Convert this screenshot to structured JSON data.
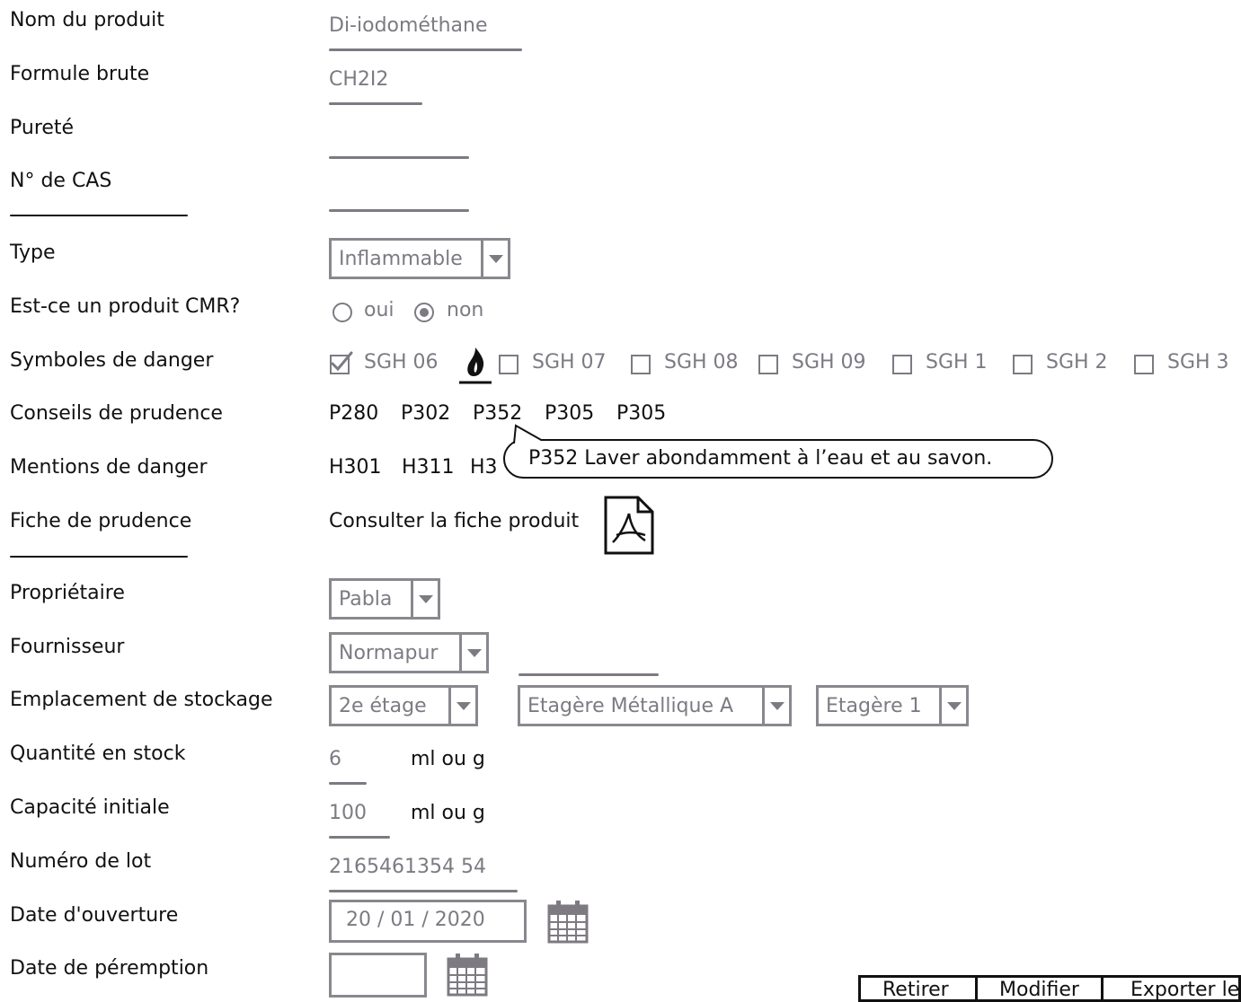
{
  "labels": {
    "product_name": "Nom du produit",
    "formula": "Formule brute",
    "purity": "Pureté",
    "cas": "N° de CAS",
    "type": "Type",
    "cmr": "Est-ce un produit CMR?",
    "hazard_symbols": "Symboles de danger",
    "precautions": "Conseils de prudence",
    "hazard_statements": "Mentions de danger",
    "safety_sheet": "Fiche de prudence",
    "owner": "Propriétaire",
    "supplier": "Fournisseur",
    "storage": "Emplacement de stockage",
    "quantity": "Quantité en stock",
    "capacity": "Capacité initiale",
    "lot": "Numéro de lot",
    "open_date": "Date d'ouverture",
    "expiry_date": "Date de péremption"
  },
  "fields": {
    "product_name": "Di-iodométhane",
    "formula": "CH2I2",
    "purity": "",
    "cas": "",
    "type": "Inflammable",
    "cmr_yes": "oui",
    "cmr_no": "non",
    "cmr_selected": "non",
    "owner": "Pabla",
    "supplier": "Normapur",
    "storage_floor": "2e étage",
    "storage_shelf": "Etagère Métallique A",
    "storage_level": "Etagère 1",
    "quantity": "6",
    "quantity_unit": "ml ou g",
    "capacity": "100",
    "capacity_unit": "ml ou g",
    "lot": "2165461354 54",
    "open_date": "20 / 01 / 2020",
    "expiry_date": ""
  },
  "hazard_symbols": [
    {
      "label": "SGH 06",
      "checked": true
    },
    {
      "label": "SGH 07",
      "checked": false
    },
    {
      "label": "SGH 08",
      "checked": false
    },
    {
      "label": "SGH 09",
      "checked": false
    },
    {
      "label": "SGH 1",
      "checked": false
    },
    {
      "label": "SGH 2",
      "checked": false
    },
    {
      "label": "SGH 3",
      "checked": false
    }
  ],
  "precautions": [
    "P280",
    "P302",
    "P352",
    "P305",
    "P305"
  ],
  "hazard_statements": [
    "H301",
    "H311",
    "H3"
  ],
  "tooltip": "P352 Laver abondamment à l’eau et au savon.",
  "safety_sheet_link": "Consulter la fiche produit",
  "icons": {
    "flame": "flame-icon",
    "pdf": "pdf-icon",
    "calendar": "calendar-icon",
    "dropdown": "chevron-down-icon"
  },
  "buttons": {
    "remove": "Retirer",
    "edit": "Modifier",
    "export": "Exporter le"
  }
}
